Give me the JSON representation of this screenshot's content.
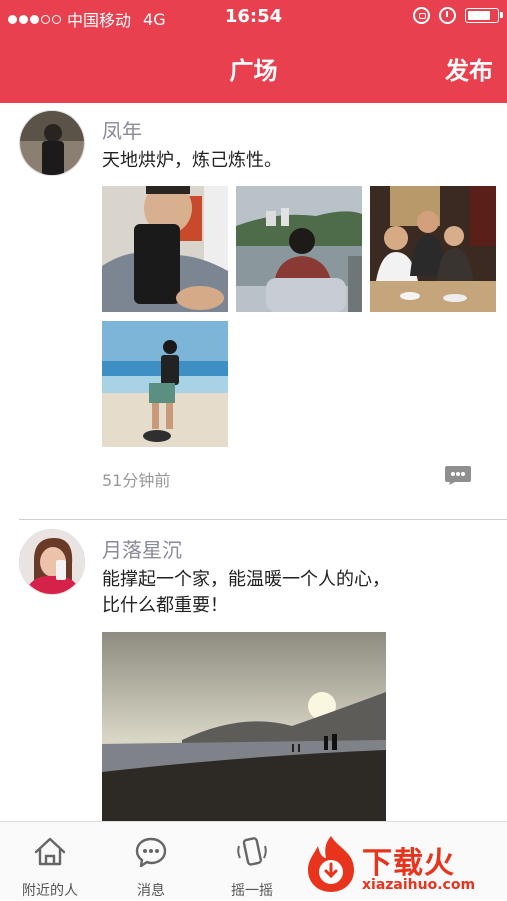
{
  "status_bar": {
    "carrier": "中国移动",
    "network": "4G",
    "time": "16:54",
    "signal_bars_filled": 3,
    "signal_bars_total": 5,
    "battery_level": 0.85
  },
  "nav": {
    "title": "广场",
    "publish_label": "发布"
  },
  "posts": [
    {
      "username": "凤年",
      "text": "天地烘炉，炼己炼性。",
      "photos": [
        "selfie-photo",
        "lake-photo",
        "dinner-group-photo",
        "beach-photo"
      ],
      "time": "51分钟前",
      "comment_icon": "comment-icon"
    },
    {
      "username": "月落星沉",
      "text": "能撑起一个家，能温暖一个人的心，比什么都重要！",
      "photos": [
        "sunset-beach-photo"
      ]
    }
  ],
  "tabs": [
    {
      "label": "附近的人",
      "icon": "home-icon"
    },
    {
      "label": "消息",
      "icon": "chat-icon"
    },
    {
      "label": "摇一摇",
      "icon": "phone-shake-icon"
    }
  ],
  "watermark": {
    "text": "下载火",
    "url_text": "xiazaihuo.com"
  },
  "colors": {
    "brand_red": "#e8404f",
    "username_gray": "#8a8a9a"
  }
}
